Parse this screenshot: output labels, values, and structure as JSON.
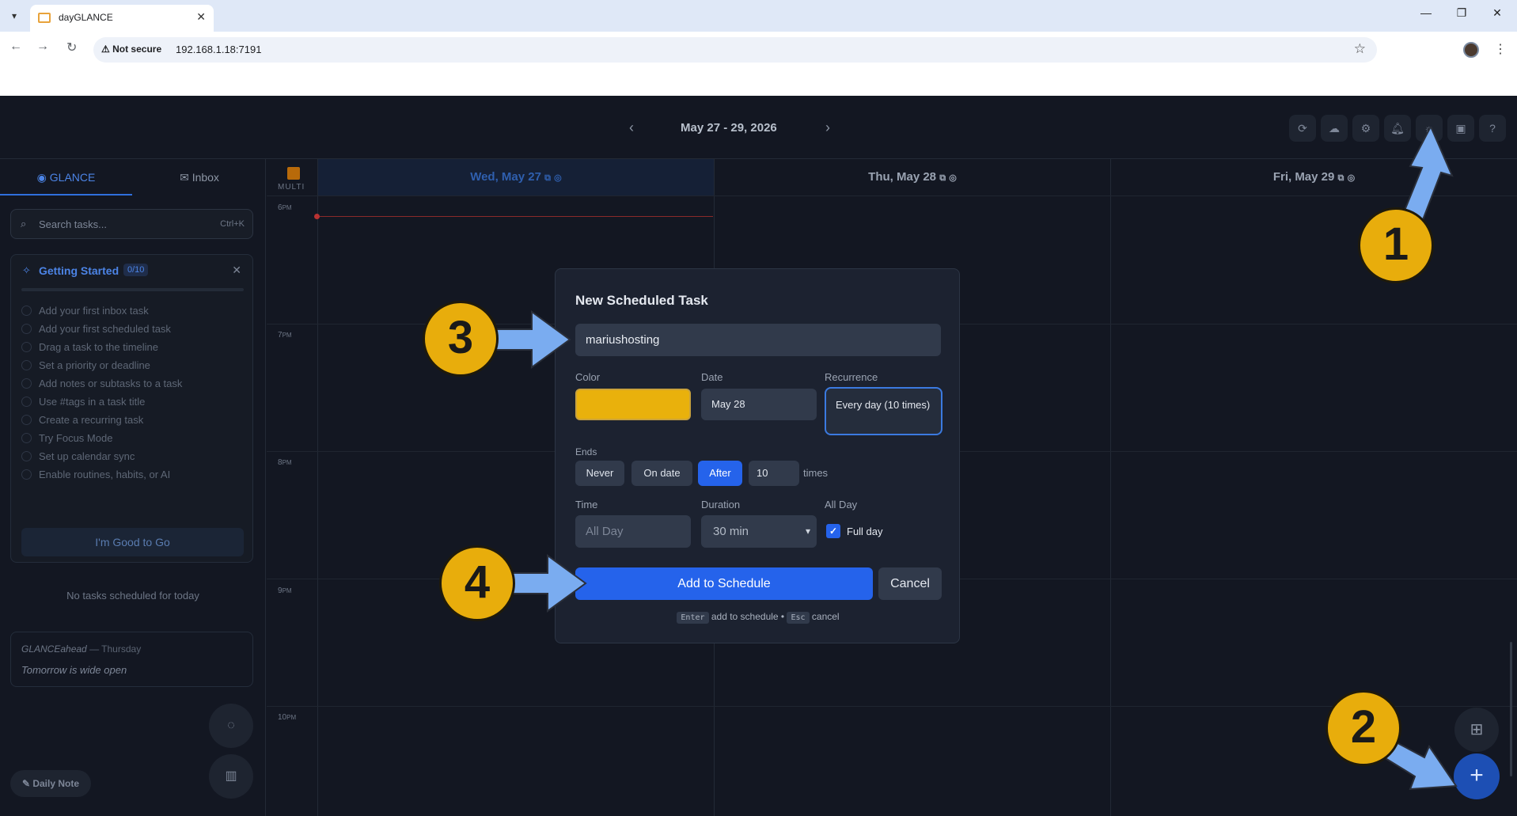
{
  "browser": {
    "tab_title": "dayGLANCE",
    "security_label": "Not secure",
    "url": "192.168.1.18:7191"
  },
  "header": {
    "date_range": "May 27 - 29, 2026",
    "buttons": [
      "sync-icon",
      "cloud-icon",
      "gear-icon",
      "bell-icon",
      "sun-icon",
      "save-icon",
      "help-icon"
    ]
  },
  "sidebar": {
    "tabs": [
      {
        "label": "GLANCE",
        "icon": "eye-icon"
      },
      {
        "label": "Inbox",
        "icon": "inbox-icon"
      }
    ],
    "search": {
      "placeholder": "Search tasks...",
      "shortcut": "Ctrl+K"
    },
    "getting_started": {
      "title": "Getting Started",
      "count": "0/10",
      "progress": 0,
      "items": [
        "Add your first inbox task",
        "Add your first scheduled task",
        "Drag a task to the timeline",
        "Set a priority or deadline",
        "Add notes or subtasks to a task",
        "Use #tags in a task title",
        "Create a recurring task",
        "Try Focus Mode",
        "Set up calendar sync",
        "Enable routines, habits, or AI"
      ],
      "button": "I'm Good to Go"
    },
    "empty_text": "No tasks scheduled for today",
    "ahead": {
      "title": "GLANCEahead",
      "day": "— Thursday",
      "text": "Tomorrow is wide open"
    },
    "daily_note": "Daily Note"
  },
  "timeline": {
    "multi_label": "MULTI",
    "days": [
      {
        "label": "Wed, May 27",
        "today": true
      },
      {
        "label": "Thu, May 28",
        "today": false
      },
      {
        "label": "Fri, May 29",
        "today": false
      }
    ],
    "hours": [
      {
        "num": "6",
        "ampm": "PM"
      },
      {
        "num": "7",
        "ampm": "PM"
      },
      {
        "num": "8",
        "ampm": "PM"
      },
      {
        "num": "9",
        "ampm": "PM"
      },
      {
        "num": "10",
        "ampm": "PM"
      }
    ]
  },
  "modal": {
    "title": "New Scheduled Task",
    "task_name": "mariushosting",
    "color_label": "Color",
    "color_value": "#e9b10c",
    "date_label": "Date",
    "date_value": "May 28",
    "recurrence_label": "Recurrence",
    "recurrence_value": "Every day (10 times)",
    "ends_label": "Ends",
    "ends_options": [
      "Never",
      "On date",
      "After"
    ],
    "ends_selected": "After",
    "times_value": "10",
    "times_label": "times",
    "time_label": "Time",
    "time_value": "All Day",
    "duration_label": "Duration",
    "duration_value": "30 min",
    "allday_label": "All Day",
    "allday_checkbox_label": "Full day",
    "allday_checked": true,
    "add_button": "Add to Schedule",
    "cancel_button": "Cancel",
    "hint": {
      "key1": "Enter",
      "text1": "add to schedule •",
      "key2": "Esc",
      "text2": "cancel"
    }
  },
  "annotations": {
    "badge_1": "1",
    "badge_2": "2",
    "badge_3": "3",
    "badge_4": "4",
    "badge_color": "#e8ad0c",
    "arrow_color": "#7aacf0"
  }
}
